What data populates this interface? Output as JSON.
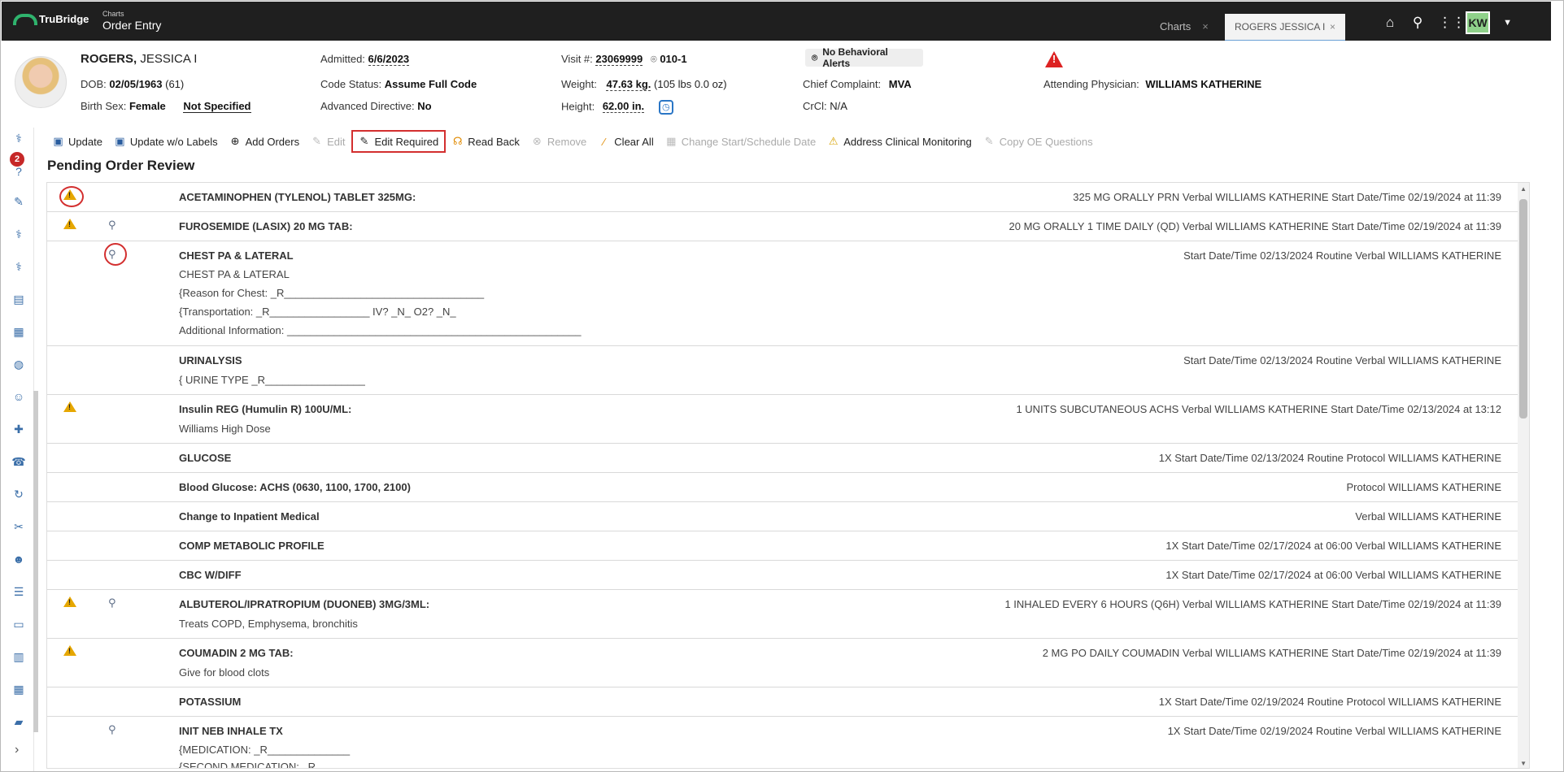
{
  "topbar": {
    "logo": "TruBridge",
    "app_sub": "Charts",
    "app_title": "Order Entry",
    "tab_charts": "Charts",
    "tab_patient": "ROGERS JESSICA I",
    "user_initials": "KW"
  },
  "patient": {
    "last_name": "ROGERS,",
    "first_name": " JESSICA I",
    "dob_label": "DOB:",
    "dob": "02/05/1963",
    "age": "(61)",
    "sex_label": "Birth Sex:",
    "sex": "Female",
    "not_specified": "Not Specified",
    "admitted_label": "Admitted:",
    "admitted": "6/6/2023",
    "code_label": "Code Status:",
    "code": "Assume Full Code",
    "adv_label": "Advanced Directive:",
    "adv": "No",
    "visit_label": "Visit #:",
    "visit": "23069999",
    "room": "010-1",
    "weight_label": "Weight:",
    "weight": "47.63 kg.",
    "weight_lbs": "(105 lbs 0.0 oz)",
    "height_label": "Height:",
    "height": "62.00 in.",
    "behavioral": "No Behavioral Alerts",
    "complaint_label": "Chief Complaint:",
    "complaint": "MVA",
    "crcl_label": "CrCl:",
    "crcl": "N/A",
    "physician_label": "Attending Physician:",
    "physician": "WILLIAMS KATHERINE"
  },
  "sidebar": {
    "badge": "2"
  },
  "toolbar": {
    "update": "Update",
    "update_wo": "Update w/o Labels",
    "add": "Add Orders",
    "edit": "Edit",
    "edit_required": "Edit Required",
    "read_back": "Read Back",
    "remove": "Remove",
    "clear_all": "Clear All",
    "change_start": "Change Start/Schedule Date",
    "address": "Address Clinical Monitoring",
    "copy": "Copy OE Questions"
  },
  "section_title": "Pending Order Review",
  "orders": [
    {
      "title": "ACETAMINOPHEN (TYLENOL) TABLET 325MG:",
      "detail": "325 MG ORALLY PRN Verbal WILLIAMS KATHERINE Start Date/Time 02/19/2024 at 11:39",
      "sub": []
    },
    {
      "title": "FUROSEMIDE (LASIX) 20 MG TAB:",
      "detail": "20 MG ORALLY 1 TIME DAILY (QD) Verbal WILLIAMS KATHERINE Start Date/Time 02/19/2024 at 11:39",
      "sub": []
    },
    {
      "title": "CHEST PA & LATERAL",
      "detail": "Start Date/Time 02/13/2024 Routine Verbal WILLIAMS KATHERINE",
      "sub": [
        "CHEST PA & LATERAL",
        "{Reason for Chest: _R__________________________________",
        "{Transportation: _R_________________ IV? _N_ O2? _N_",
        "Additional Information: __________________________________________________"
      ]
    },
    {
      "title": "URINALYSIS",
      "detail": "Start Date/Time 02/13/2024 Routine Verbal WILLIAMS KATHERINE",
      "sub": [
        "{ URINE TYPE _R_________________"
      ]
    },
    {
      "title": "Insulin REG (Humulin R) 100U/ML:",
      "detail": "1 UNITS SUBCUTANEOUS ACHS Verbal WILLIAMS KATHERINE Start Date/Time 02/13/2024 at 13:12",
      "sub": [
        "Williams High Dose"
      ]
    },
    {
      "title": "GLUCOSE",
      "detail": "1X Start Date/Time 02/13/2024 Routine Protocol WILLIAMS KATHERINE",
      "sub": []
    },
    {
      "title": "Blood Glucose: ACHS (0630, 1100, 1700, 2100)",
      "detail": "Protocol WILLIAMS KATHERINE",
      "sub": []
    },
    {
      "title": "Change to Inpatient Medical",
      "detail": "Verbal WILLIAMS KATHERINE",
      "sub": []
    },
    {
      "title": "COMP METABOLIC PROFILE",
      "detail": "1X Start Date/Time 02/17/2024 at 06:00 Verbal WILLIAMS KATHERINE",
      "sub": []
    },
    {
      "title": "CBC W/DIFF",
      "detail": "1X Start Date/Time 02/17/2024 at 06:00 Verbal WILLIAMS KATHERINE",
      "sub": []
    },
    {
      "title": "ALBUTEROL/IPRATROPIUM (DUONEB) 3MG/3ML:",
      "detail": "1 INHALED EVERY 6 HOURS (Q6H) Verbal WILLIAMS KATHERINE Start Date/Time 02/19/2024 at 11:39",
      "sub": [
        "Treats COPD, Emphysema, bronchitis"
      ]
    },
    {
      "title": "COUMADIN 2 MG TAB:",
      "detail": "2 MG PO DAILY COUMADIN Verbal WILLIAMS KATHERINE Start Date/Time 02/19/2024 at 11:39",
      "sub": [
        "Give for blood clots"
      ]
    },
    {
      "title": "POTASSIUM",
      "detail": "1X Start Date/Time 02/19/2024 Routine Protocol WILLIAMS KATHERINE",
      "sub": []
    },
    {
      "title": "INIT NEB INHALE TX",
      "detail": "1X Start Date/Time 02/19/2024 Routine Verbal WILLIAMS KATHERINE",
      "sub": [
        "{MEDICATION: _R______________",
        "{SECOND MEDICATION: _R_"
      ]
    }
  ]
}
